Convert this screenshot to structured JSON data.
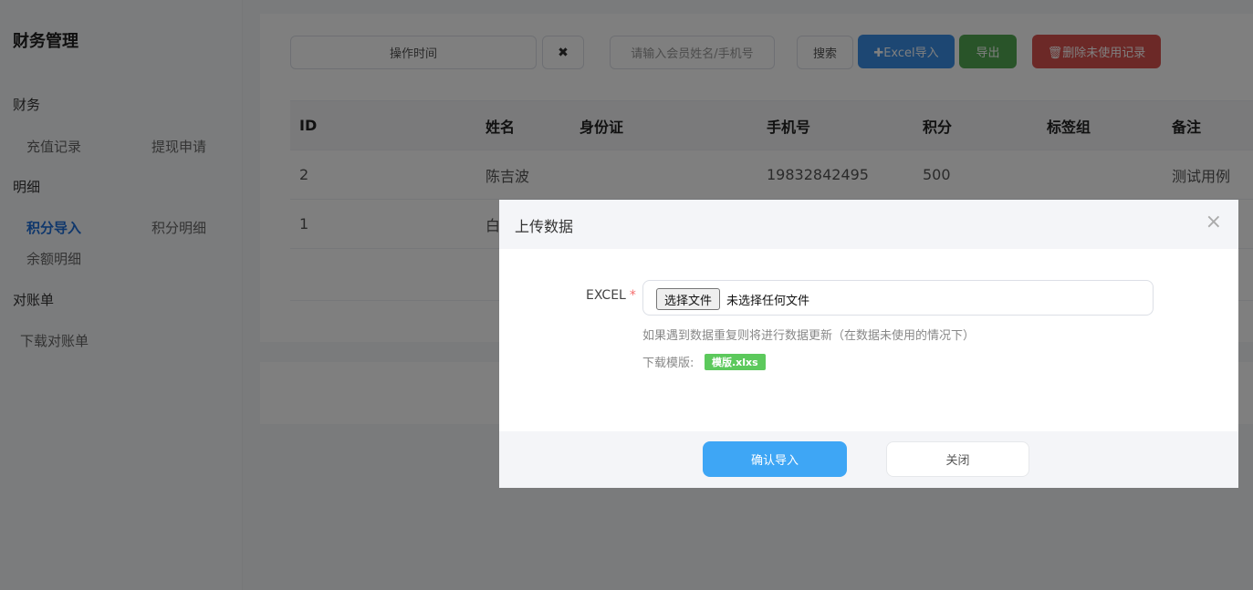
{
  "sidebar": {
    "title": "财务管理",
    "sections": [
      {
        "label": "财务"
      },
      {
        "label": "明细"
      },
      {
        "label": "对账单"
      }
    ],
    "items": [
      {
        "label": "充值记录"
      },
      {
        "label": "提现申请"
      },
      {
        "label": "积分导入"
      },
      {
        "label": "积分明细"
      },
      {
        "label": "余额明细"
      },
      {
        "label": "下载对账单"
      }
    ]
  },
  "toolbar": {
    "date_label": "操作时间",
    "clear_label": "✖",
    "search_placeholder": "请输入会员姓名/手机号",
    "search_label": "搜索",
    "excel_import_label": "✚Excel导入",
    "export_label": "导出",
    "delete_unused_label": "🗑删除未使用记录"
  },
  "table": {
    "headers": [
      "ID",
      "姓名",
      "身份证",
      "手机号",
      "积分",
      "标签组",
      "备注"
    ],
    "rows": [
      [
        "2",
        "陈吉波",
        "",
        "19832842495",
        "500",
        "",
        "测试用例"
      ],
      [
        "1",
        "白",
        "",
        "",
        "",
        "",
        ""
      ]
    ]
  },
  "modal": {
    "title": "上传数据",
    "close_icon": "×",
    "field_label": "EXCEL",
    "required_mark": "*",
    "choose_file_label": "选择文件",
    "no_file_text": "未选择任何文件",
    "hint": "如果遇到数据重复则将进行数据更新（在数据未使用的情况下）",
    "template_label": "下载模版:",
    "template_file": "模版.xlxs",
    "confirm_label": "确认导入",
    "close_label": "关闭"
  },
  "colors": {
    "primary": "#3a8ee6",
    "success": "#53a953",
    "danger": "#d9534f",
    "active_nav": "#1e6fd9"
  }
}
